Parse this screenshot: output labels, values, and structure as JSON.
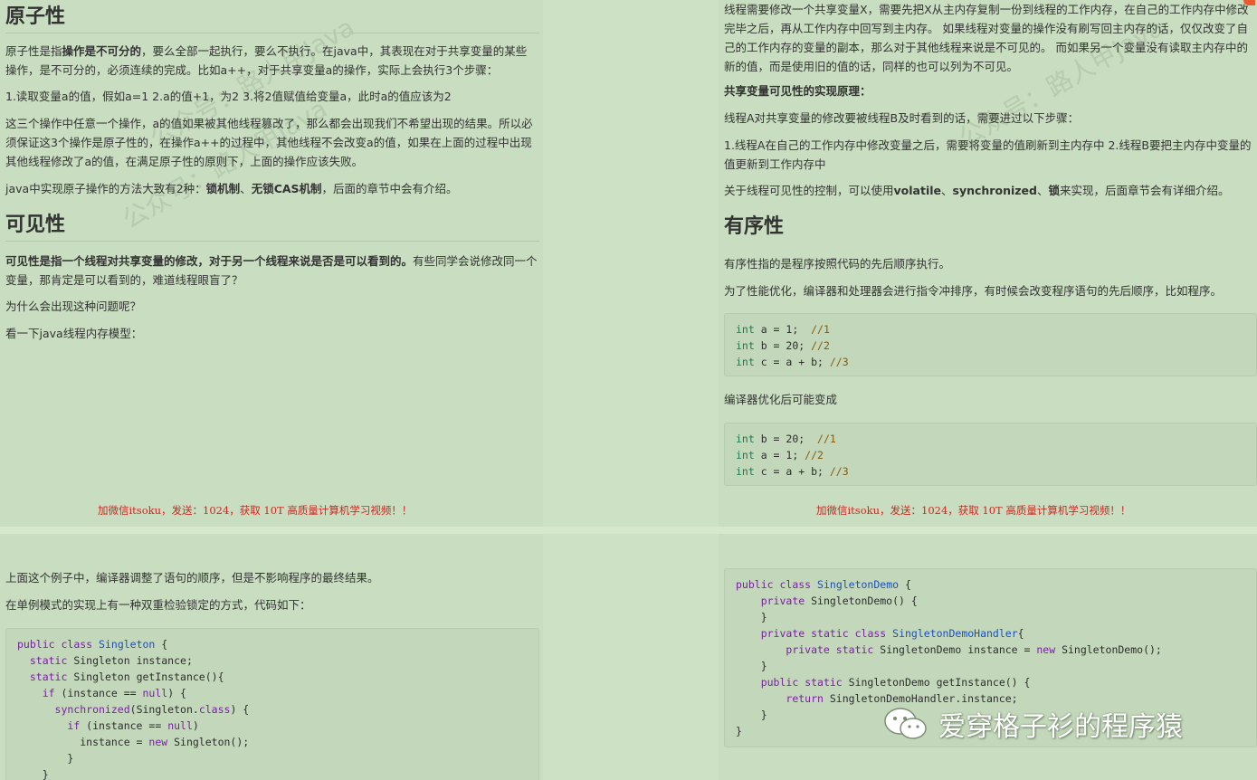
{
  "page1": {
    "h_atomic": "原子性",
    "p1_pre": "原子性是指",
    "p1_bold": "操作是不可分的",
    "p1_post": "，要么全部一起执行，要么不执行。在java中，其表现在对于共享变量的某些操作，是不可分的，必须连续的完成。比如a++，对于共享变量a的操作，实际上会执行3个步骤：",
    "p2": "1.读取变量a的值，假如a=1 2.a的值+1，为2 3.将2值赋值给变量a，此时a的值应该为2",
    "p3": "这三个操作中任意一个操作，a的值如果被其他线程篡改了，那么都会出现我们不希望出现的结果。所以必须保证这3个操作是原子性的，在操作a++的过程中，其他线程不会改变a的值，如果在上面的过程中出现其他线程修改了a的值，在满足原子性的原则下，上面的操作应该失败。",
    "p4_pre": "java中实现原子操作的方法大致有2种：",
    "p4_b1": "锁机制",
    "p4_mid": "、",
    "p4_b2": "无锁CAS机制",
    "p4_post": "，后面的章节中会有介绍。",
    "h_visible": "可见性",
    "p5_bold": "可见性是指一个线程对共享变量的修改，对于另一个线程来说是否是可以看到的。",
    "p5_post": "有些同学会说修改同一个变量，那肯定是可以看到的，难道线程眼盲了？",
    "p6": "为什么会出现这种问题呢？",
    "p7": "看一下java线程内存模型：",
    "ad": "加微信itsoku，发送：1024，获取 10T 高质量计算机学习视频！！",
    "watermark": "公众号：路人甲Java"
  },
  "page2": {
    "p1": "线程需要修改一个共享变量X，需要先把X从主内存复制一份到线程的工作内存，在自己的工作内存中修改完毕之后，再从工作内存中回写到主内存。 如果线程对变量的操作没有刷写回主内存的话，仅仅改变了自己的工作内存的变量的副本，那么对于其他线程来说是不可见的。 而如果另一个变量没有读取主内存中的新的值，而是使用旧的值的话，同样的也可以列为不可见。",
    "p2_bold": "共享变量可见性的实现原理：",
    "p3": "线程A对共享变量的修改要被线程B及时看到的话，需要进过以下步骤：",
    "p4": "1.线程A在自己的工作内存中修改变量之后，需要将变量的值刷新到主内存中 2.线程B要把主内存中变量的值更新到工作内存中",
    "p5_pre": "关于线程可见性的控制，可以使用",
    "p5_b1": "volatile",
    "p5_s1": "、",
    "p5_b2": "synchronized",
    "p5_s2": "、",
    "p5_b3": "锁",
    "p5_post": "来实现，后面章节会有详细介绍。",
    "h_order": "有序性",
    "p6": "有序性指的是程序按照代码的先后顺序执行。",
    "p7": "为了性能优化，编译器和处理器会进行指令冲排序，有时候会改变程序语句的先后顺序，比如程序。",
    "code1": [
      {
        "kw": "int",
        "rest": " a = 1;  ",
        "cm": "//1"
      },
      {
        "kw": "int",
        "rest": " b = 20; ",
        "cm": "//2"
      },
      {
        "kw": "int",
        "rest": " c = a + b; ",
        "cm": "//3"
      }
    ],
    "p8": "编译器优化后可能变成",
    "code2": [
      {
        "kw": "int",
        "rest": " b = 20;  ",
        "cm": "//1"
      },
      {
        "kw": "int",
        "rest": " a = 1; ",
        "cm": "//2"
      },
      {
        "kw": "int",
        "rest": " c = a + b; ",
        "cm": "//3"
      }
    ],
    "ad": "加微信itsoku，发送：1024，获取 10T 高质量计算机学习视频！！",
    "watermark": "公众号：路人甲Java"
  },
  "page3": {
    "p1": "上面这个例子中，编译器调整了语句的顺序，但是不影响程序的最终结果。",
    "p2": "在单例模式的实现上有一种双重检验锁定的方式，代码如下：",
    "code_lines": [
      "public class Singleton {",
      "  static Singleton instance;",
      "  static Singleton getInstance(){",
      "    if (instance == null) {",
      "      synchronized(Singleton.class) {",
      "        if (instance == null)",
      "          instance = new Singleton();",
      "        }",
      "    }"
    ]
  },
  "page4": {
    "code_lines": [
      "public class SingletonDemo {",
      "    private SingletonDemo() {",
      "    }",
      "    private static class SingletonDemoHandler{",
      "        private static SingletonDemo instance = new SingletonDemo();",
      "    }",
      "    public static SingletonDemo getInstance() {",
      "        return SingletonDemoHandler.instance;",
      "    }",
      "}"
    ],
    "logo_text": "爱穿格子衫的程序猿"
  }
}
